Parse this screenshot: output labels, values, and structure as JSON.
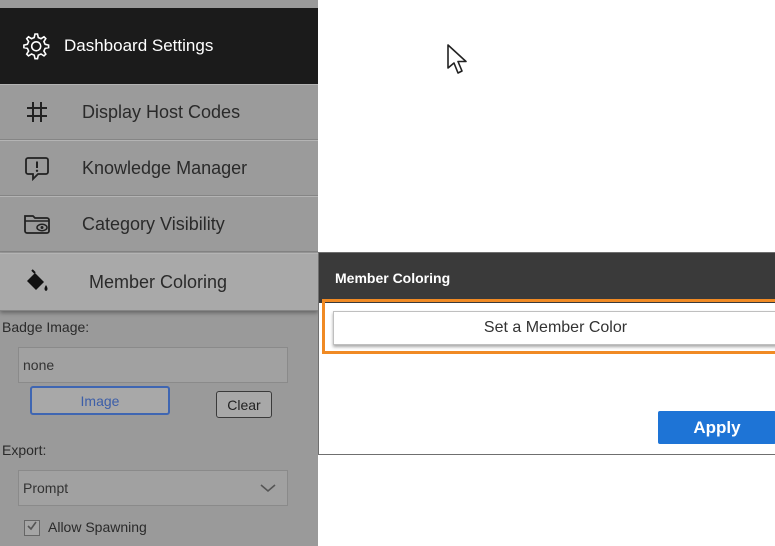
{
  "sidebar": {
    "header": {
      "title": "Dashboard Settings",
      "icon": "gear-icon"
    },
    "items": [
      {
        "label": "Display Host Codes",
        "icon": "hash-icon"
      },
      {
        "label": "Knowledge Manager",
        "icon": "speech-bubble-alert-icon"
      },
      {
        "label": "Category Visibility",
        "icon": "folder-eye-icon"
      },
      {
        "label": "Member Coloring",
        "icon": "paint-bucket-icon",
        "active": true
      }
    ],
    "badge_image": {
      "label": "Badge Image:",
      "value": "none",
      "image_button": "Image",
      "clear_button": "Clear"
    },
    "export": {
      "label": "Export:",
      "value": "Prompt"
    },
    "allow_spawning": {
      "label": "Allow Spawning",
      "checked": true
    }
  },
  "dialog": {
    "title": "Member Coloring",
    "set_color_button": "Set a Member Color",
    "apply_button": "Apply"
  },
  "colors": {
    "header_bg": "#1b1b1b",
    "sidebar_bg": "#9a9a9a",
    "dialog_header_bg": "#3a3a3a",
    "highlight": "#f08a24",
    "apply_blue": "#1e74d6"
  }
}
